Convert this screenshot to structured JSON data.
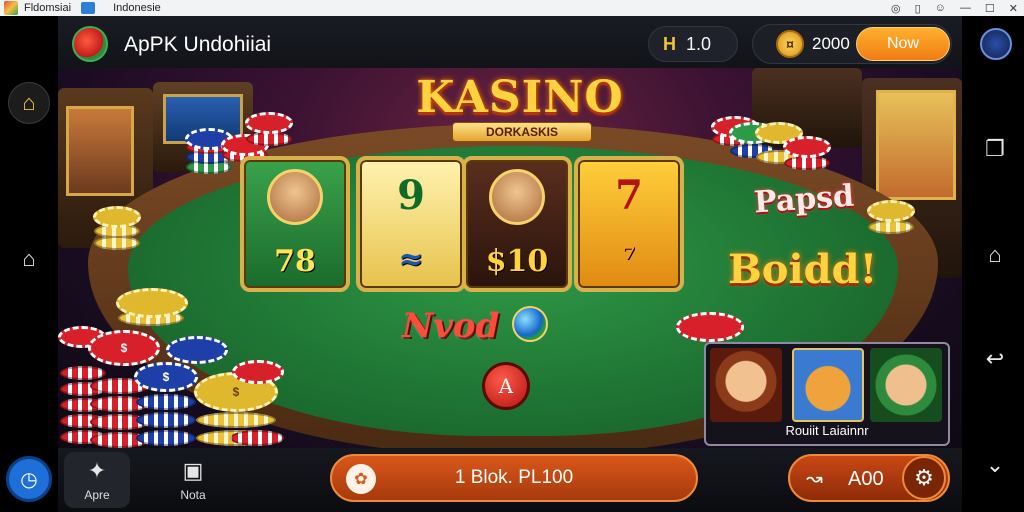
{
  "window": {
    "title": "Fldomsiai",
    "subtitle": "Indonesie"
  },
  "topbar": {
    "app_title": "ApPK Undohiiai",
    "level_label": "H",
    "level_value": "1.0",
    "coins": "2000",
    "now_button": "Now"
  },
  "stage": {
    "title": "KASINO",
    "subtitle": "DORKASKIS",
    "reels": [
      {
        "symbol": "78"
      },
      {
        "symbol": "9"
      },
      {
        "symbol": "$10"
      },
      {
        "symbol": "7"
      }
    ],
    "badge_paid": "Papsd",
    "badge_bold": "Boidd!",
    "banner": "Nvod",
    "center_button": "A",
    "promo_caption": "Rouiit Laiainnr"
  },
  "bottombar": {
    "apps_label": "Apre",
    "note_label": "Nota",
    "spin_label": "1 Blok. PL100",
    "bet_value": "A00"
  },
  "colors": {
    "accent": "#f07d12",
    "felt": "#1f7534",
    "gold": "#ffd23f"
  },
  "icons": [
    "home-icon",
    "clock-icon",
    "back-icon",
    "recent-apps-icon",
    "gear-icon",
    "coin-icon"
  ]
}
